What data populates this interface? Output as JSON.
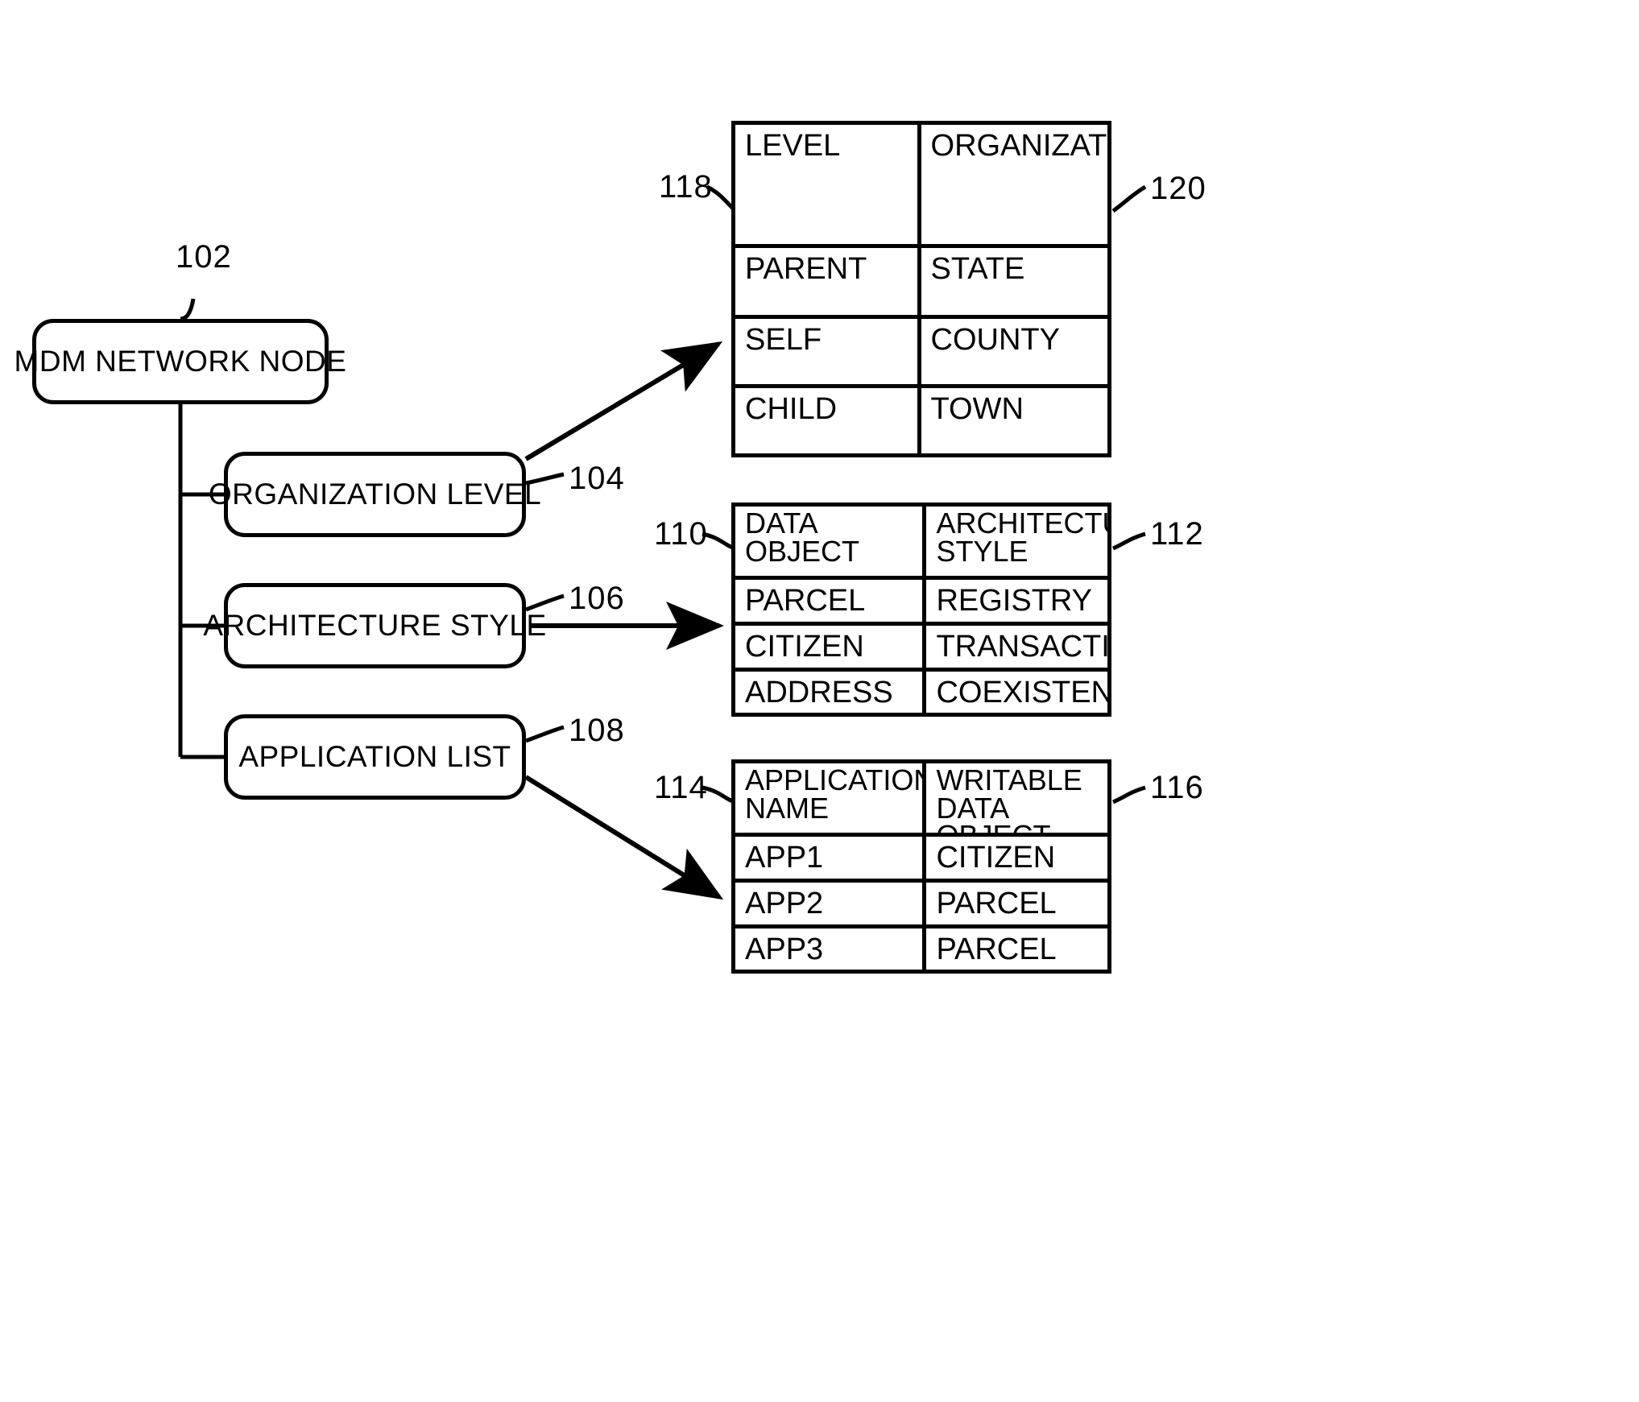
{
  "diagram": {
    "nodes": [
      {
        "id": "mdm-network-node",
        "label": "MDM NETWORK NODE",
        "ref": "102"
      },
      {
        "id": "organization-level",
        "label": "ORGANIZATION LEVEL",
        "ref": "104"
      },
      {
        "id": "architecture-style",
        "label": "ARCHITECTURE STYLE",
        "ref": "106"
      },
      {
        "id": "application-list",
        "label": "APPLICATION LIST",
        "ref": "108"
      }
    ],
    "reference_numerals": {
      "root_node": "102",
      "organization_level": "104",
      "architecture_style": "106",
      "application_list": "108",
      "data_object_column": "110",
      "architecture_style_column": "112",
      "application_name_column": "114",
      "writable_data_object_list_column": "116",
      "level_column": "118",
      "organization_column": "120"
    },
    "tables": {
      "organization": {
        "name": "organization-level-table",
        "columns": [
          "LEVEL",
          "ORGANIZATION"
        ],
        "column_refs": [
          "118",
          "120"
        ],
        "rows": [
          [
            "PARENT",
            "STATE"
          ],
          [
            "SELF",
            "COUNTY"
          ],
          [
            "CHILD",
            "TOWN"
          ]
        ]
      },
      "architecture": {
        "name": "architecture-style-table",
        "columns": [
          "DATA OBJECT",
          "ARCHITECTURE STYLE"
        ],
        "column_header_lines": [
          [
            "DATA OBJECT"
          ],
          [
            "ARCHITECTURE",
            "STYLE"
          ]
        ],
        "column_refs": [
          "110",
          "112"
        ],
        "rows": [
          [
            "PARCEL",
            "REGISTRY"
          ],
          [
            "CITIZEN",
            "TRANSACTION"
          ],
          [
            "ADDRESS",
            "COEXISTENCE"
          ]
        ]
      },
      "applications": {
        "name": "application-list-table",
        "columns": [
          "APPLICATION NAME",
          "WRITABLE DATA OBJECT LIST"
        ],
        "column_header_lines": [
          [
            "APPLICATION",
            "NAME"
          ],
          [
            "WRITABLE DATA",
            "OBJECT LIST"
          ]
        ],
        "column_refs": [
          "114",
          "116"
        ],
        "rows": [
          [
            "APP1",
            "CITIZEN"
          ],
          [
            "APP2",
            "PARCEL"
          ],
          [
            "APP3",
            "PARCEL"
          ]
        ]
      }
    },
    "colors": {
      "line": "#000000",
      "background": "#ffffff"
    }
  }
}
